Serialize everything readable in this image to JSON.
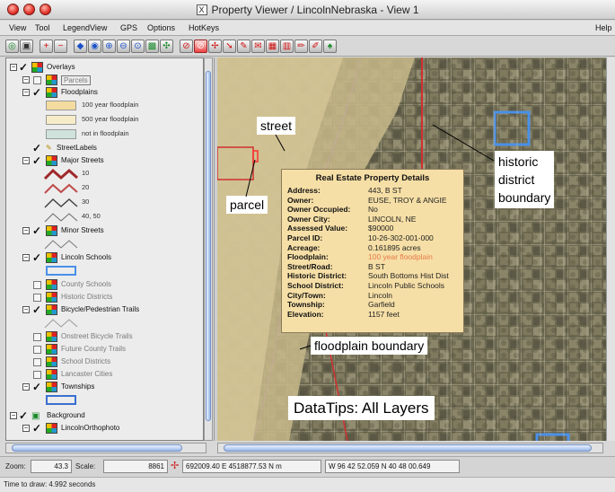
{
  "window": {
    "title": "Property Viewer / LincolnNebraska - View 1",
    "x_badge": "X"
  },
  "menu": {
    "items": [
      "View",
      "Tool",
      "LegendView",
      "GPS",
      "Options",
      "HotKeys"
    ],
    "help": "Help"
  },
  "layers": {
    "overlays": "Overlays",
    "parcels": "Parcels",
    "floodplains": "Floodplains",
    "flood_legend": [
      "100 year floodplain",
      "500 year floodplain",
      "not in floodplain"
    ],
    "street_labels": "StreetLabels",
    "major_streets": "Major Streets",
    "major_legend": [
      "10",
      "20",
      "30",
      "40, 50"
    ],
    "minor_streets": "Minor Streets",
    "lincoln_schools": "Lincoln Schools",
    "county_schools": "County Schools",
    "historic_districts": "Historic Districts",
    "bike_trails": "Bicycle/Pedestrian Trails",
    "onstreet_trails": "Onstreet Bicycle Trails",
    "future_trails": "Future County Trails",
    "school_districts": "School Districts",
    "lancaster_cities": "Lancaster Cities",
    "townships": "Townships",
    "background": "Background",
    "ortho": "LincolnOrthophoto"
  },
  "datatip": {
    "title": "Real Estate Property Details",
    "rows": [
      {
        "k": "Address:",
        "v": "443, B ST"
      },
      {
        "k": "Owner:",
        "v": "EUSE, TROY & ANGIE"
      },
      {
        "k": "Owner Occupied:",
        "v": "No"
      },
      {
        "k": "Owner City:",
        "v": "LINCOLN, NE"
      },
      {
        "k": "Assessed Value:",
        "v": "$90000"
      },
      {
        "k": "Parcel ID:",
        "v": "10-26-302-001-000"
      },
      {
        "k": "Acreage:",
        "v": "0.161895 acres"
      },
      {
        "k": "Floodplain:",
        "v": "100 year floodplain"
      },
      {
        "k": "Street/Road:",
        "v": "B ST"
      },
      {
        "k": "Historic District:",
        "v": "South Bottoms Hist Dist"
      },
      {
        "k": "School District:",
        "v": "Lincoln Public Schools"
      },
      {
        "k": "City/Town:",
        "v": "Lincoln"
      },
      {
        "k": "Township:",
        "v": "Garfield"
      },
      {
        "k": "Elevation:",
        "v": "1157 feet"
      }
    ],
    "floodplain_color": "#e87a4a"
  },
  "callouts": {
    "street": "street",
    "parcel": "parcel",
    "historic": [
      "historic",
      "district",
      "boundary"
    ],
    "floodplain": "floodplain boundary",
    "datatips": "DataTips: All Layers"
  },
  "status": {
    "zoom_label": "Zoom:",
    "zoom_value": "43.3",
    "scale_label": "Scale:",
    "scale_value": "8861",
    "coords": "692009.40 E   4518877.53 N m",
    "latlon": "W 96 42 52.059   N 40 48 00.649",
    "draw_time": "Time to draw: 4.992 seconds"
  },
  "colors": {
    "floodplain_100": "#f4dca0",
    "floodplain_500": "#f7ecc8",
    "not_floodplain": "#cfe3dc",
    "school_box": "#4a90e8",
    "historic_line": "#d03030"
  }
}
